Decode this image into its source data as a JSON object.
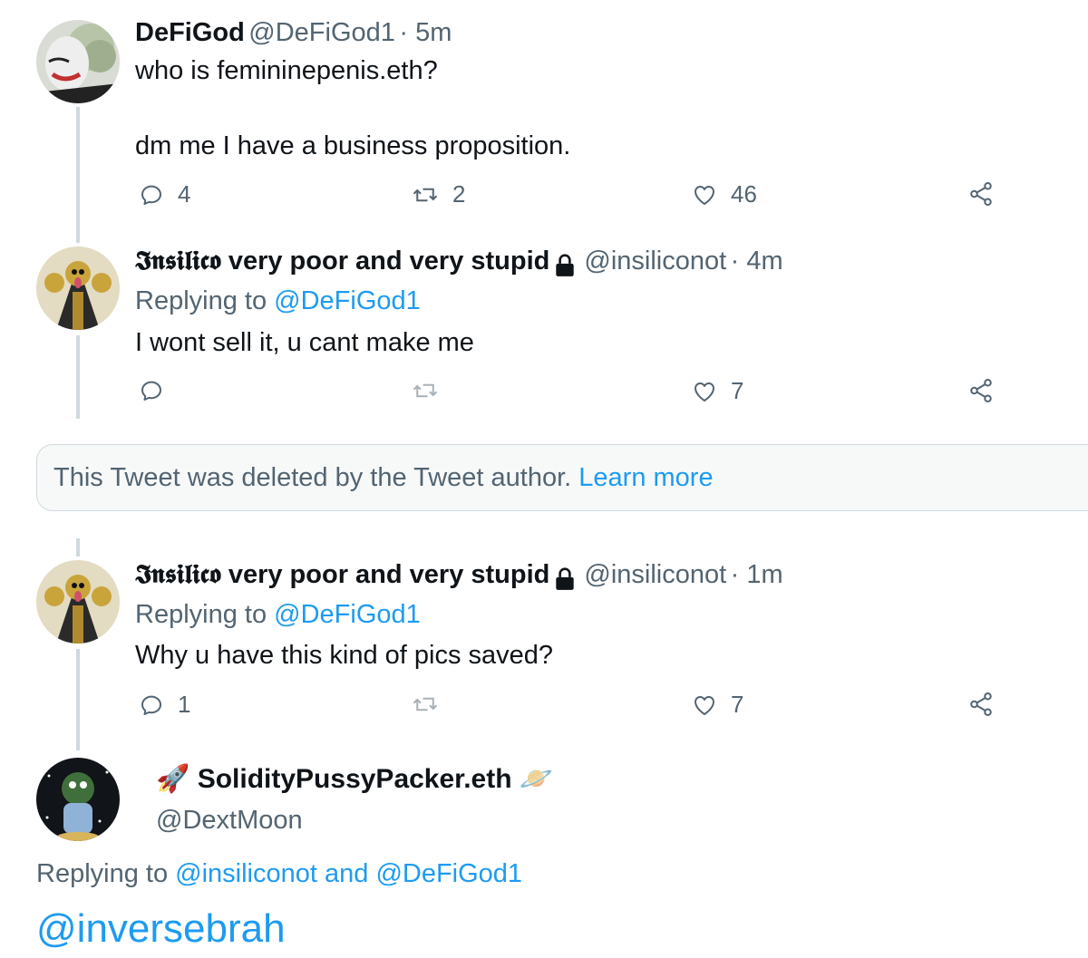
{
  "tweets": [
    {
      "name": "DeFiGod",
      "handle": "@DeFiGod1",
      "time": "· 5m",
      "line1": "who is femininepenis.eth?",
      "line2": "dm me I have a business proposition.",
      "replies": "4",
      "retweets": "2",
      "likes": "46"
    },
    {
      "name": "𝕴𝖓𝖘𝖎𝖑𝖎𝖈𝖔 very poor and very stupid",
      "handle": "@insiliconot",
      "time": "· 4m",
      "replying_prefix": "Replying to ",
      "replying_to": "@DeFiGod1",
      "text": "I wont sell it, u cant make me",
      "replies": "",
      "retweets": "",
      "likes": "7"
    },
    {
      "name": "𝕴𝖓𝖘𝖎𝖑𝖎𝖈𝖔 very poor and very stupid",
      "handle": "@insiliconot",
      "time": "· 1m",
      "replying_prefix": "Replying to ",
      "replying_to": "@DeFiGod1",
      "text": "Why u have this kind of pics saved?",
      "replies": "1",
      "retweets": "",
      "likes": "7"
    }
  ],
  "deleted": {
    "text": "This Tweet was deleted by the Tweet author.",
    "learn_more": "Learn more"
  },
  "main_tweet": {
    "name_prefix_emoji": "🚀",
    "name": "SolidityPussyPacker.eth",
    "name_suffix_emoji": "🪐",
    "handle": "@DextMoon",
    "replying_prefix": "Replying to ",
    "replying_to_1": "@insiliconot",
    "replying_and": " and ",
    "replying_to_2": "@DeFiGod1",
    "text": "@inversebrah"
  },
  "icons": {
    "reply": "reply-icon",
    "retweet": "retweet-icon",
    "like": "heart-icon",
    "share": "share-icon",
    "lock": "lock-icon"
  },
  "colors": {
    "link": "#1d9bf0",
    "secondary": "#536471",
    "thread_line": "#cfd9de"
  }
}
